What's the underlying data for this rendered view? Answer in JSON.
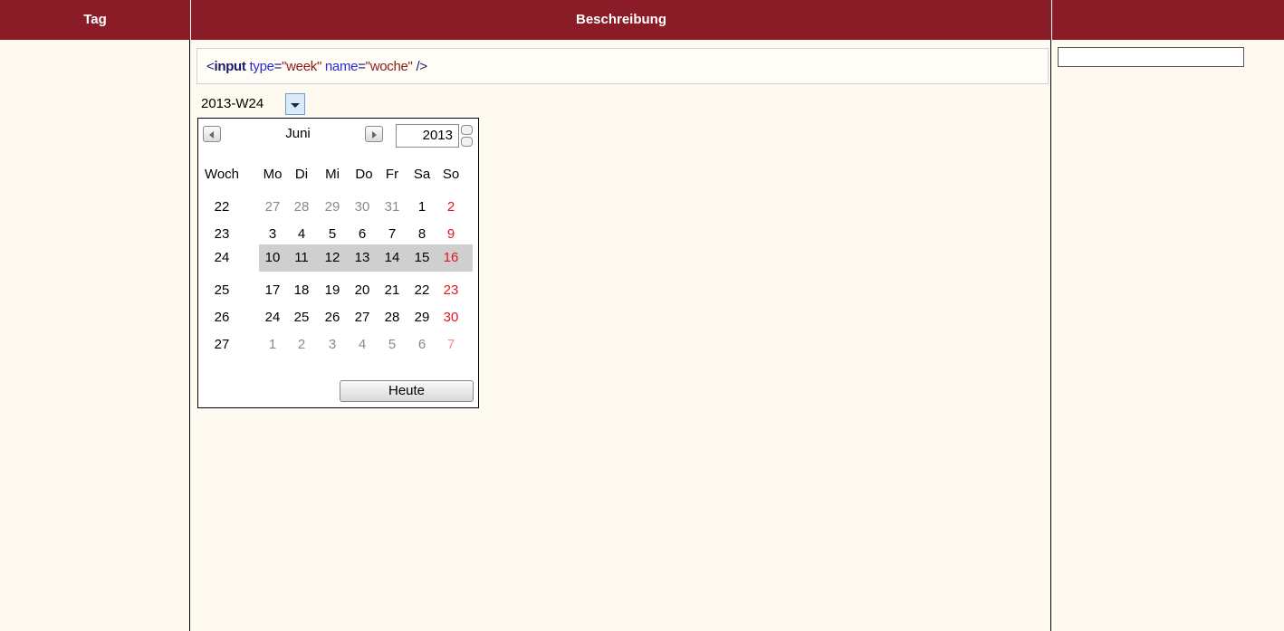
{
  "header": {
    "col_tag": "Tag",
    "col_desc": "Beschreibung"
  },
  "code": {
    "open": "<",
    "tag": "input",
    "attr1_name": "type",
    "attr1_eq": "=",
    "attr1_value": "\"week\"",
    "attr2_name": "name",
    "attr2_eq": "=",
    "attr2_value": "\"woche\"",
    "close": "/>"
  },
  "week_input": {
    "value": "2013-W24"
  },
  "picker": {
    "month": "Juni",
    "year": "2013",
    "week_header": "Woch",
    "weekdays": [
      "Mo",
      "Di",
      "Mi",
      "Do",
      "Fr",
      "Sa",
      "So"
    ],
    "selected_week": "24",
    "rows": [
      {
        "week": "22",
        "days": [
          "27",
          "28",
          "29",
          "30",
          "31",
          "1",
          "2"
        ],
        "other": [
          true,
          true,
          true,
          true,
          true,
          false,
          false
        ]
      },
      {
        "week": "23",
        "days": [
          "3",
          "4",
          "5",
          "6",
          "7",
          "8",
          "9"
        ],
        "other": [
          false,
          false,
          false,
          false,
          false,
          false,
          false
        ]
      },
      {
        "week": "24",
        "days": [
          "10",
          "11",
          "12",
          "13",
          "14",
          "15",
          "16"
        ],
        "other": [
          false,
          false,
          false,
          false,
          false,
          false,
          false
        ]
      },
      {
        "week": "25",
        "days": [
          "17",
          "18",
          "19",
          "20",
          "21",
          "22",
          "23"
        ],
        "other": [
          false,
          false,
          false,
          false,
          false,
          false,
          false
        ]
      },
      {
        "week": "26",
        "days": [
          "24",
          "25",
          "26",
          "27",
          "28",
          "29",
          "30"
        ],
        "other": [
          false,
          false,
          false,
          false,
          false,
          false,
          false
        ]
      },
      {
        "week": "27",
        "days": [
          "1",
          "2",
          "3",
          "4",
          "5",
          "6",
          "7"
        ],
        "other": [
          true,
          true,
          true,
          true,
          true,
          true,
          true
        ]
      }
    ],
    "today_label": "Heute"
  },
  "colors": {
    "header_bg": "#891c27",
    "body_bg": "#fffaf0",
    "sunday": "#e4151f",
    "selection": "#cfcfcf"
  }
}
